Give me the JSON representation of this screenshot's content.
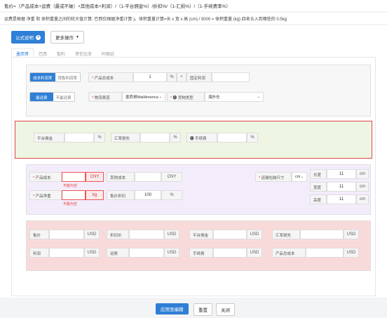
{
  "top_formula": "售价=（产品成本+运费（最或不破）+其他成本+利润）/（1-平台佣金%）/折扣%/（1-汇损%）/（1-手续费率%）",
  "info_text": "运费是根据 净重 和 体积重量之间的较大值计算; 巴西仅根据净重计算 )。体积重量计算=长 x 宽 x 高 (cm) / 5000 = 体积重量 (kg) 四舍五入到哪些的 0.5kg",
  "toolbar": {
    "formula_btn": "公式说明",
    "more_btn": "更多操作"
  },
  "tabs": [
    "墨西哥",
    "巴西",
    "智利",
    "哥伦比亚",
    "阿根廷"
  ],
  "section1": {
    "mode_seg": [
      "成本利润率",
      "销售利润率"
    ],
    "cost_label": "产品总成本",
    "cost_value": "1",
    "percent": "%",
    "plus": "+",
    "fixed_profit_label": "固定利润",
    "ship_seg": [
      "最运费",
      "不最运费"
    ],
    "channel_label": "物流渠道",
    "channel_value": "墨西哥MailAmerica",
    "cargo_label": "货物类型",
    "cargo_value": "海外仓"
  },
  "section2": {
    "platform_fee": "平台佣金",
    "exchange_loss": "汇率损失",
    "handling_fee": "手续费",
    "percent": "%"
  },
  "section3": {
    "product_cost": "产品成本",
    "cny": "CNY",
    "other_cost": "其他成本",
    "cost_error": "不能为空",
    "net_weight": "产品净重",
    "kg": "kg",
    "discount": "售价折扣",
    "discount_value": "100",
    "percent": "%",
    "weight_error": "不能为空",
    "package_size": "运输包装尺寸",
    "unit_select": "cm",
    "length": "长度",
    "width": "宽度",
    "height": "高度",
    "dim_value": "11",
    "cm": "cm"
  },
  "section4": {
    "row1": [
      "售价",
      "折扣价",
      "平台佣金",
      "汇率损失"
    ],
    "row2": [
      "利润",
      "运费",
      "手续费",
      "产品总成本"
    ],
    "usd": "USD"
  },
  "footer": {
    "apply": "应用至编辑",
    "reset": "重置",
    "close": "关闭"
  },
  "colors": {
    "primary": "#2f7fd6",
    "section2_bg": "#eef5e2",
    "section2_border": "#e04848",
    "section3_bg": "#f3ecfb",
    "section4_bg": "#f9dada",
    "section1_bg": "#f7f7f7"
  }
}
